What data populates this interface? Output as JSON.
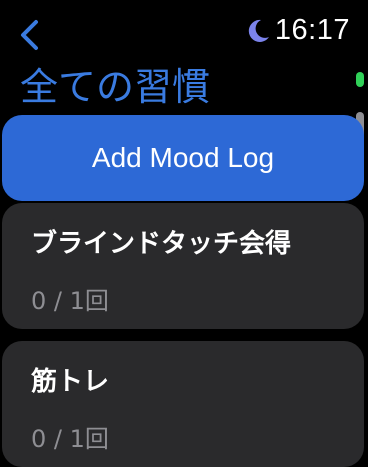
{
  "status": {
    "time": "16:17"
  },
  "header": {
    "title": "全ての習慣"
  },
  "actions": {
    "add_label": "Add Mood Log"
  },
  "habits": [
    {
      "name": "ブラインドタッチ会得",
      "progress": "0 / 1回"
    },
    {
      "name": "筋トレ",
      "progress": "0 / 1回"
    }
  ],
  "icons": {
    "back": "chevron-left-icon",
    "focus": "moon-icon"
  },
  "colors": {
    "accent": "#2D69D6",
    "title": "#3A7BE0",
    "card": "#2A2A2C",
    "secondary_text": "#8E8E93",
    "indicator": "#30D158",
    "moon": "#7B83EB"
  }
}
